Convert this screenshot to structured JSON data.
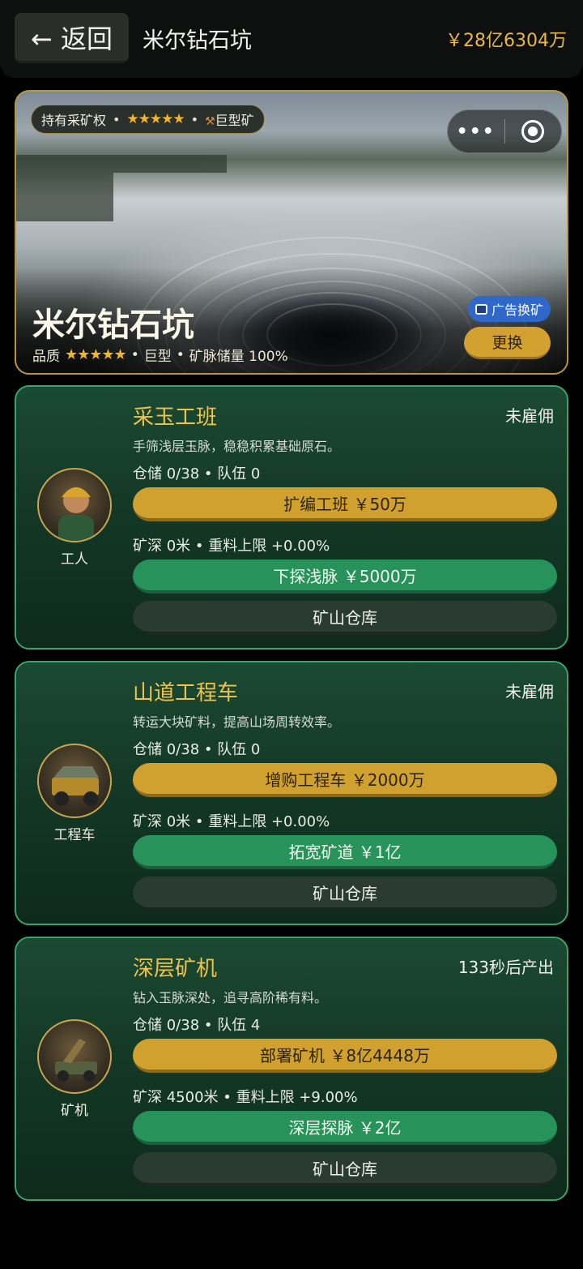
{
  "header": {
    "back_label": "← 返回",
    "title": "米尔钻石坑",
    "money": "￥28亿6304万"
  },
  "hero": {
    "tag_rights": "持有采矿权",
    "tag_stars": "★★★★★",
    "tag_size": "巨型矿",
    "name": "米尔钻石坑",
    "quality_label": "品质",
    "quality_stars": "★★★★★",
    "size": "巨型",
    "reserve": "矿脉储量 100%",
    "ad_button": "广告换矿",
    "swap_button": "更换",
    "dot": "•"
  },
  "cards": [
    {
      "title": "采玉工班",
      "status": "未雇佣",
      "desc": "手筛浅层玉脉，稳稳积累基础原石。",
      "stats1": "仓储 0/38 • 队伍 0",
      "gold_button": "扩编工班 ￥50万",
      "stats2": "矿深 0米 • 重料上限 +0.00%",
      "green_button": "下探浅脉 ￥5000万",
      "dark_button": "矿山仓库",
      "avatar_icon": "worker-icon",
      "avatar_label": "工人"
    },
    {
      "title": "山道工程车",
      "status": "未雇佣",
      "desc": "转运大块矿料，提高山场周转效率。",
      "stats1": "仓储 0/38 • 队伍 0",
      "gold_button": "增购工程车 ￥2000万",
      "stats2": "矿深 0米 • 重料上限 +0.00%",
      "green_button": "拓宽矿道 ￥1亿",
      "dark_button": "矿山仓库",
      "avatar_icon": "truck-icon",
      "avatar_label": "工程车"
    },
    {
      "title": "深层矿机",
      "status": "133秒后产出",
      "desc": "钻入玉脉深处，追寻高阶稀有料。",
      "stats1": "仓储 0/38 • 队伍 4",
      "gold_button": "部署矿机 ￥8亿4448万",
      "stats2": "矿深 4500米 • 重料上限 +9.00%",
      "green_button": "深层探脉 ￥2亿",
      "dark_button": "矿山仓库",
      "avatar_icon": "drill-machine-icon",
      "avatar_label": "矿机"
    }
  ],
  "colors": {
    "accent_gold": "#d0a12f",
    "accent_green": "#27925a",
    "card_border": "#3aa36a",
    "money_text": "#e9b840"
  }
}
